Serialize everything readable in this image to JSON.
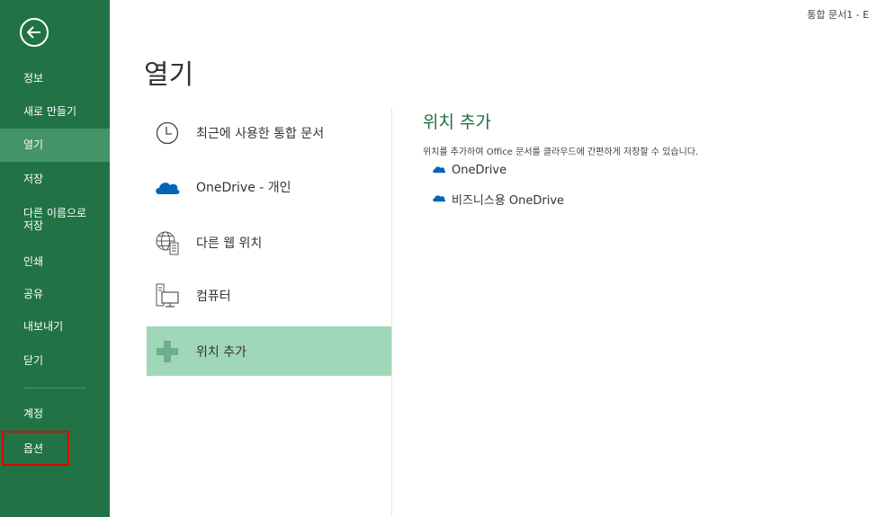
{
  "window": {
    "title": "통합 문서1 - E"
  },
  "sidebar": {
    "items": [
      {
        "label": "정보"
      },
      {
        "label": "새로 만들기"
      },
      {
        "label": "열기",
        "selected": true
      },
      {
        "label": "저장"
      },
      {
        "label": "다른 이름으로\n저장"
      },
      {
        "label": "인쇄"
      },
      {
        "label": "공유"
      },
      {
        "label": "내보내기"
      },
      {
        "label": "닫기"
      },
      {
        "label": "계정"
      },
      {
        "label": "옵션"
      }
    ]
  },
  "main": {
    "title": "열기",
    "locations": [
      {
        "label": "최근에 사용한 통합 문서",
        "icon": "clock-icon"
      },
      {
        "label": "OneDrive - 개인",
        "icon": "onedrive-cloud-icon"
      },
      {
        "label": "다른 웹 위치",
        "icon": "globe-web-icon"
      },
      {
        "label": "컴퓨터",
        "icon": "computer-icon"
      },
      {
        "label": "위치 추가",
        "icon": "plus-icon",
        "selected": true
      }
    ]
  },
  "add_place": {
    "title": "위치 추가",
    "description": "위치를 추가하여 Office 문서를 클라우드에 간편하게 저장할 수 있습니다.",
    "services": [
      {
        "label": "OneDrive"
      },
      {
        "label": "비즈니스용 OneDrive"
      }
    ]
  },
  "colors": {
    "sidebar_bg": "#217346",
    "sidebar_selected": "#439467",
    "accent": "#217346",
    "location_selected": "#a0d7b8",
    "highlight_box": "#e00000"
  }
}
